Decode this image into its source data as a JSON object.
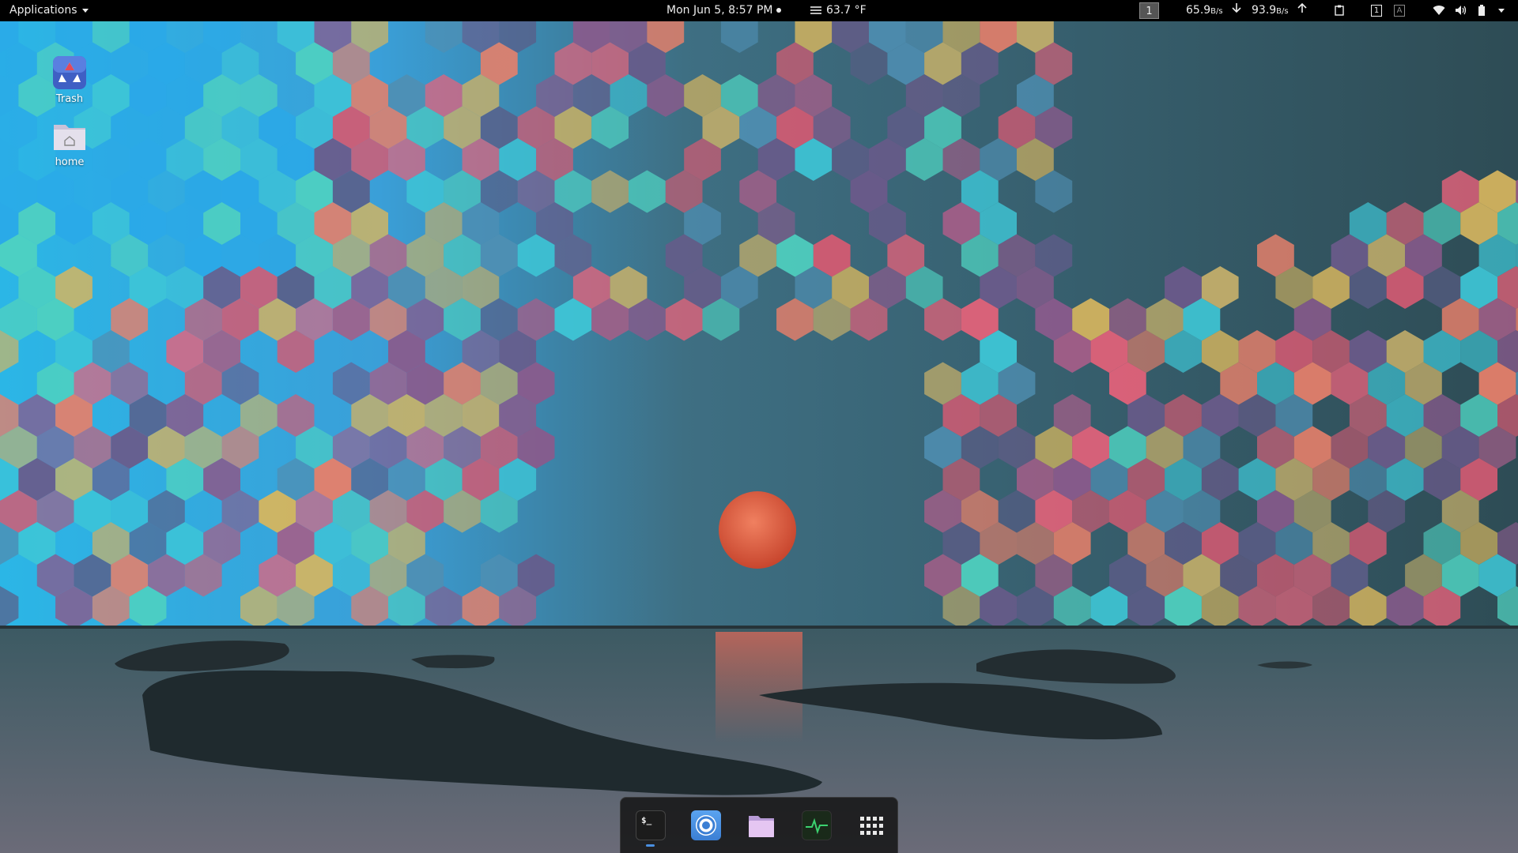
{
  "topbar": {
    "applications_label": "Applications",
    "clock": "Mon Jun  5,  8:57 PM",
    "weather": "63.7 °F",
    "workspace": "1",
    "net_down_value": "65.9",
    "net_down_unit": "B/s",
    "net_up_value": "93.9",
    "net_up_unit": "B/s",
    "kb_indicator_a": "1",
    "kb_indicator_b": "A"
  },
  "desktop_icons": [
    {
      "label": "Trash",
      "icon": "recycle-trash-icon"
    },
    {
      "label": "home",
      "icon": "home-folder-icon"
    }
  ],
  "dock": {
    "items": [
      {
        "name": "terminal",
        "icon": "terminal-icon",
        "glyph": "$_",
        "running": true
      },
      {
        "name": "chromium",
        "icon": "chromium-icon",
        "running": false
      },
      {
        "name": "files",
        "icon": "files-folder-icon",
        "running": false
      },
      {
        "name": "system-monitor",
        "icon": "system-monitor-icon",
        "running": false
      },
      {
        "name": "show-applications",
        "icon": "app-grid-icon",
        "running": false
      }
    ]
  },
  "colors": {
    "topbar_bg": "#000000",
    "dock_bg": "#141414",
    "accent": "#4a90e2",
    "moon": "#e8664a"
  }
}
